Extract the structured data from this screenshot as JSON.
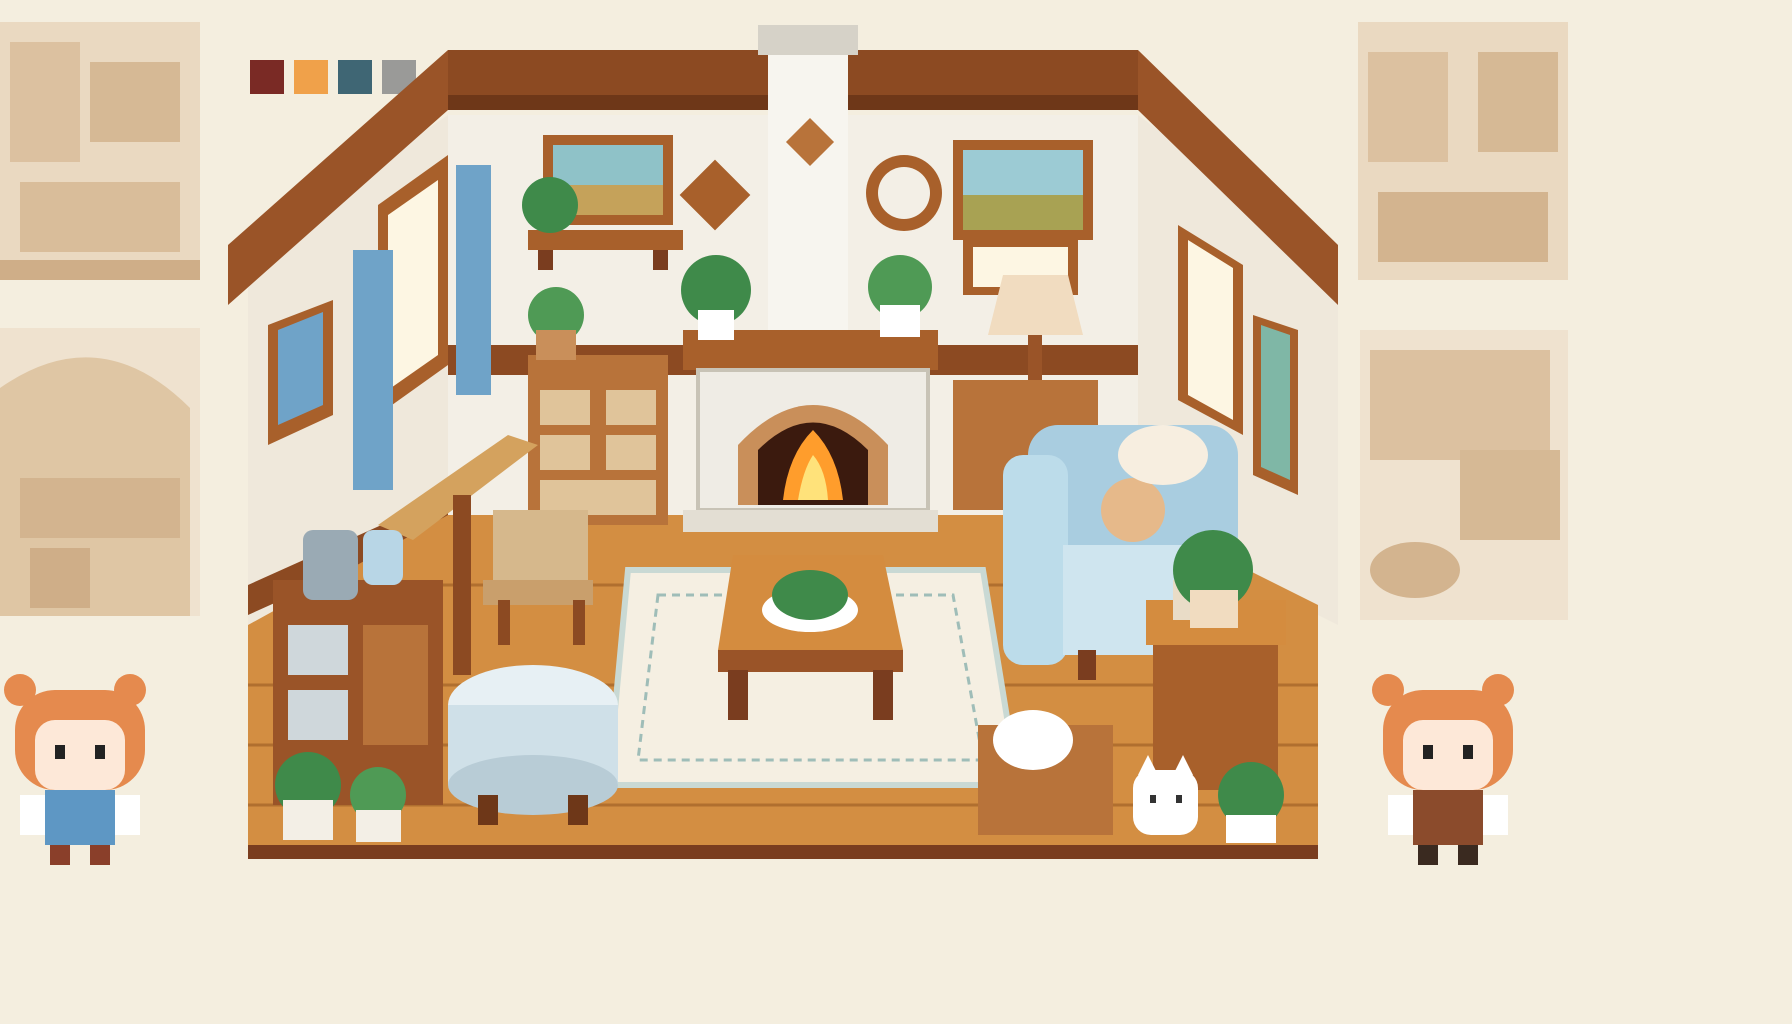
{
  "scene": {
    "kind": "pixel-art cozy living room asset sheet",
    "palette": [
      "#7a2a25",
      "#f0a14a",
      "#3f6674",
      "#9a9a98"
    ],
    "colors": {
      "background": "#f4eedf",
      "wall": "#f3efe6",
      "wood_dark": "#7a3d1f",
      "wood_mid": "#a8602b",
      "wood_light": "#d48c3f",
      "floor": "#d38e42",
      "floor_line": "#b06f2f",
      "brick": "#e9e6df",
      "fire": "#ff9d2c",
      "curtain": "#6fa3c8",
      "sofa": "#a9cde0",
      "rug": "#f5efe2",
      "plant": "#3f8a4a",
      "sepia": "#e3cfb4"
    },
    "icons": [
      "fireplace-icon",
      "window-icon",
      "curtain-icon",
      "painting-icon",
      "shelf-icon",
      "dresser-icon",
      "lamp-icon",
      "sofa-icon",
      "coffee-table-icon",
      "rug-icon",
      "ottoman-icon",
      "plant-icon",
      "cat-icon",
      "basket-icon",
      "chair-icon",
      "desk-icon",
      "character-sprite-icon"
    ]
  }
}
